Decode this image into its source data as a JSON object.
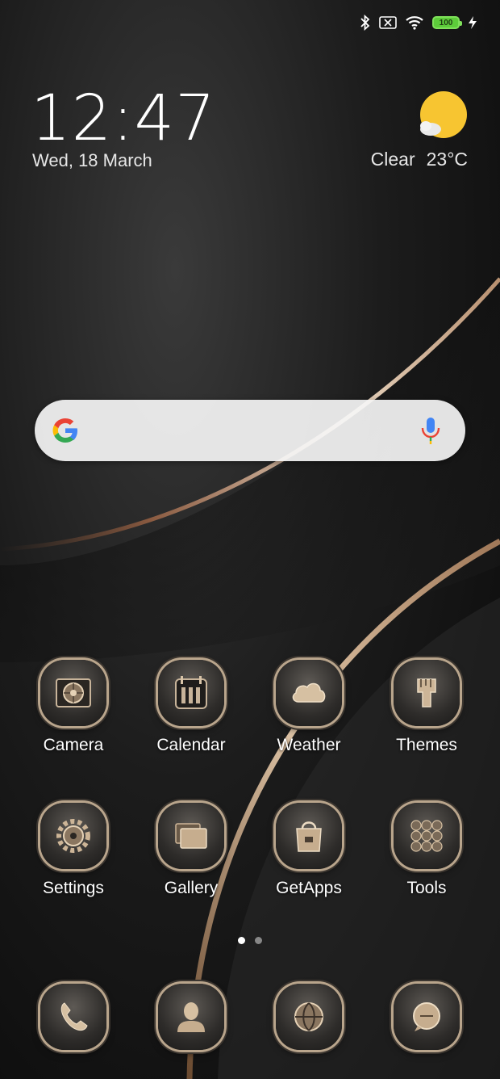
{
  "status_bar": {
    "icons": [
      "bluetooth-icon",
      "no-sim-icon",
      "wifi-icon",
      "charging-icon"
    ],
    "battery_level": "100",
    "battery_color": "#5dcc3a"
  },
  "clock": {
    "time": "12:47",
    "date": "Wed, 18 March"
  },
  "weather_widget": {
    "condition": "Clear",
    "temperature": "23°C",
    "icon": "partly-cloudy-sun-icon"
  },
  "search_widget": {
    "logo": "google-logo-icon",
    "mic": "mic-icon"
  },
  "home_apps": [
    {
      "label": "Camera",
      "icon": "camera-icon"
    },
    {
      "label": "Calendar",
      "icon": "calendar-icon"
    },
    {
      "label": "Weather",
      "icon": "cloud-icon"
    },
    {
      "label": "Themes",
      "icon": "paintbrush-icon"
    },
    {
      "label": "Settings",
      "icon": "gear-icon"
    },
    {
      "label": "Gallery",
      "icon": "gallery-icon"
    },
    {
      "label": "GetApps",
      "icon": "shopping-bag-icon"
    },
    {
      "label": "Tools",
      "icon": "tools-grid-icon"
    }
  ],
  "page_indicator": {
    "current": 1,
    "total": 2
  },
  "dock": [
    {
      "icon": "phone-icon"
    },
    {
      "icon": "contacts-icon"
    },
    {
      "icon": "browser-globe-icon"
    },
    {
      "icon": "messaging-icon"
    }
  ],
  "colors": {
    "accent_gold": "#b9a58c",
    "background": "#1c1c1c"
  }
}
